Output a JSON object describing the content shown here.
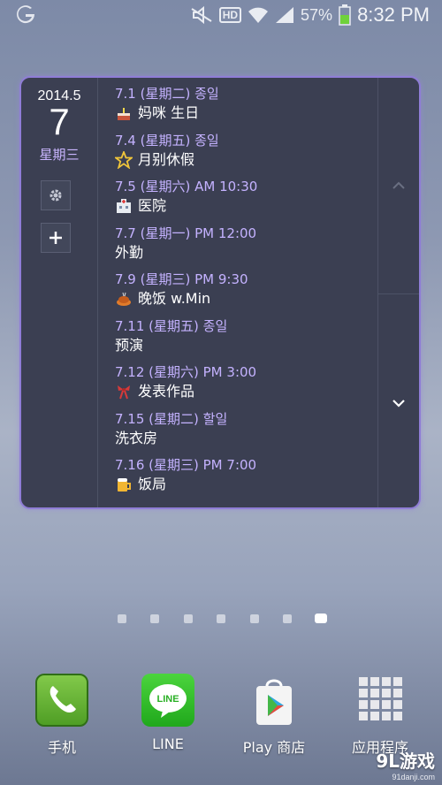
{
  "status_bar": {
    "battery": "57%",
    "time": "8:32 PM",
    "hd_label": "HD",
    "icons": [
      "carrier-logo-icon",
      "mute-icon",
      "hd-icon",
      "wifi-icon",
      "signal-icon",
      "battery-icon"
    ]
  },
  "widget": {
    "year_month": "2014.5",
    "day": "7",
    "weekday": "星期三",
    "events": [
      {
        "date": "7.1 (星期二) 종일",
        "title": "妈咪 生日",
        "icon": "cake-icon"
      },
      {
        "date": "7.4 (星期五) 종일",
        "title": "月别休假",
        "icon": "star-icon"
      },
      {
        "date": "7.5 (星期六) AM 10:30",
        "title": "医院",
        "icon": "hospital-icon"
      },
      {
        "date": "7.7 (星期一) PM 12:00",
        "title": "外勤",
        "icon": ""
      },
      {
        "date": "7.9 (星期三) PM 9:30",
        "title": "晚饭 w.Min",
        "icon": "food-icon"
      },
      {
        "date": "7.11 (星期五) 종일",
        "title": "预演",
        "icon": ""
      },
      {
        "date": "7.12 (星期六) PM 3:00",
        "title": "发表作品",
        "icon": "ribbon-icon"
      },
      {
        "date": "7.15 (星期二) 할일",
        "title": "洗衣房",
        "icon": ""
      },
      {
        "date": "7.16 (星期三) PM 7:00",
        "title": "饭局",
        "icon": "beer-icon"
      }
    ]
  },
  "pages": {
    "count": 7,
    "active": 7
  },
  "dock": [
    {
      "label": "手机",
      "icon": "phone-icon",
      "color": "#5fae2e"
    },
    {
      "label": "LINE",
      "icon": "line-icon",
      "color": "#35c02f"
    },
    {
      "label": "Play 商店",
      "icon": "play-store-icon",
      "color": "#ffffff"
    },
    {
      "label": "应用程序",
      "icon": "app-grid-icon",
      "color": "#e6e6e6"
    }
  ],
  "watermark": {
    "main": "9L游戏",
    "sub": "91danji.com"
  },
  "colors": {
    "accent": "#8f7dd6",
    "event_date": "#c4b2ff",
    "widget_bg": "#3b3f52"
  }
}
